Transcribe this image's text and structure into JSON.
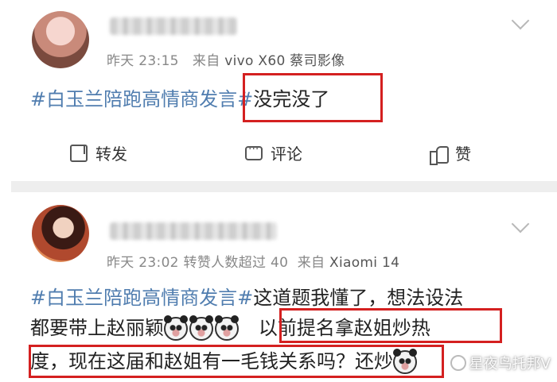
{
  "post1": {
    "username": "",
    "time": "昨天 23:15",
    "source_prefix": "来自",
    "source": "vivo X60 蔡司影像",
    "content": {
      "hashtag": "#白玉兰陪跑高情商发言#",
      "text": "没完没了"
    },
    "actions": {
      "repost_label": "转发",
      "comment_label": "评论",
      "like_label": "赞"
    }
  },
  "post2": {
    "username": "",
    "time": "昨天 23:02",
    "reposts": "转赞人数超过 40",
    "source_prefix": "来自",
    "source": "Xiaomi 14",
    "content": {
      "hashtag": "#白玉兰陪跑高情商发言#",
      "line1_text": "这道题我懂了，想法设法",
      "line2_text": "都要带上赵丽颖",
      "line2_highlight": "以前提名拿赵姐炒热",
      "line3_text": "度，现在这届和赵姐有一毛钱关系吗？还炒"
    }
  },
  "watermark": "星夜鸟托邦V",
  "colors": {
    "hashtag": "#507daf",
    "highlight_box": "#d42020",
    "meta_text": "#888888",
    "separator": "#eeeeee"
  },
  "icons": {
    "repost": "repost-icon",
    "comment": "comment-icon",
    "like": "thumbs-up-icon",
    "menu": "chevron-down-icon",
    "emoji": "panda-emoji-icon"
  }
}
